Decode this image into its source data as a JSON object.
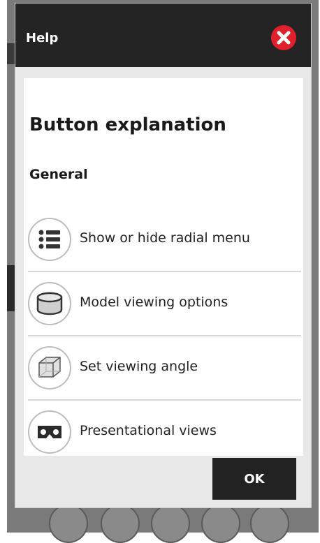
{
  "dialog": {
    "title": "Help",
    "heading": "Button explanation",
    "section": "General",
    "ok_label": "OK",
    "close_icon": "close-icon",
    "close_color": "#e0202b"
  },
  "items": [
    {
      "label": "Show or hide radial menu",
      "icon": "list-icon"
    },
    {
      "label": "Model viewing options",
      "icon": "cylinder-icon"
    },
    {
      "label": "Set viewing angle",
      "icon": "cube-icon"
    },
    {
      "label": "Presentational views",
      "icon": "vr-goggles-icon"
    }
  ]
}
